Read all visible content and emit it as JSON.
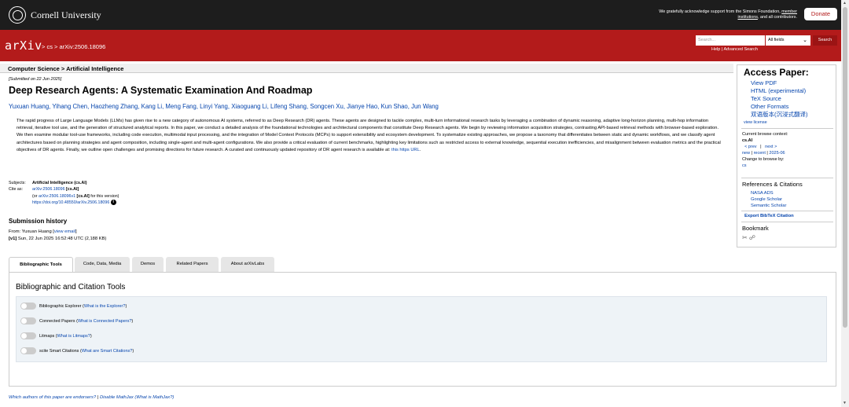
{
  "topbar": {
    "cornell": "Cornell University",
    "ack_line1": "We gratefully acknowledge support from the Simons Foundation,",
    "ack_member": "member",
    "ack_line2_a": "institutions",
    "ack_line2_b": ", and all contributors.",
    "donate": "Donate"
  },
  "header": {
    "logo": "arXiv",
    "breadcrumb": "> cs > arXiv:2506.18096",
    "search_placeholder": "Search...",
    "field_select": "All fields",
    "search_button": "Search",
    "help": "Help",
    "advanced": "Advanced Search"
  },
  "subheader": "Computer Science > Artificial Intelligence",
  "paper": {
    "submitted": "[Submitted on 22 Jun 2025]",
    "title": "Deep Research Agents: A Systematic Examination And Roadmap",
    "authors": "Yuxuan Huang, Yihang Chen, Haozheng Zhang, Kang Li, Meng Fang, Linyi Yang, Xiaoguang Li, Lifeng Shang, Songcen Xu, Jianye Hao, Kun Shao, Jun Wang",
    "abstract": "The rapid progress of Large Language Models (LLMs) has given rise to a new category of autonomous AI systems, referred to as Deep Research (DR) agents. These agents are designed to tackle complex, multi-turn informational research tasks by leveraging a combination of dynamic reasoning, adaptive long-horizon planning, multi-hop information retrieval, iterative tool use, and the generation of structured analytical reports. In this paper, we conduct a detailed analysis of the foundational technologies and architectural components that constitute Deep Research agents. We begin by reviewing information acquisition strategies, contrasting API-based retrieval methods with browser-based exploration. We then examine modular tool-use frameworks, including code execution, multimodal input processing, and the integration of Model Context Protocols (MCPs) to support extensibility and ecosystem development. To systematize existing approaches, we propose a taxonomy that differentiates between static and dynamic workflows, and we classify agent architectures based on planning strategies and agent composition, including single-agent and multi-agent configurations. We also provide a critical evaluation of current benchmarks, highlighting key limitations such as restricted access to external knowledge, sequential execution inefficiencies, and misalignment between evaluation metrics and the practical objectives of DR agents. Finally, we outline open challenges and promising directions for future research. A curated and continuously updated repository of DR agent research is available at:",
    "abstract_link": "this https URL",
    "abstract_end": ".",
    "subjects_label": "Subjects:",
    "subjects": "Artificial Intelligence (cs.AI)",
    "cite_label": "Cite as:",
    "cite_id": "arXiv:2506.18096",
    "cite_cat": "[cs.AI]",
    "cite_or_a": "(or ",
    "cite_v1": "arXiv:2506.18096v1",
    "cite_or_b": " [cs.AI]",
    "cite_or_c": " for this version)",
    "doi": "https://doi.org/10.48550/arXiv.2506.18096",
    "info_icon": "i"
  },
  "history": {
    "title": "Submission history",
    "from": "From: Yuxuan Huang [",
    "view_email": "view email",
    "from_end": "]",
    "v1": "[v1]",
    "v1_text": " Sun, 22 Jun 2025 16:52:48 UTC (2,188 KB)"
  },
  "sidebar": {
    "title": "Access Paper:",
    "links": [
      "View PDF",
      "HTML (experimental)",
      "TeX Source",
      "Other Formats",
      "双语版本(沉浸式翻译)"
    ],
    "license": "view license",
    "context_label": "Current browse context:",
    "context": "cs.AI",
    "prev": "< prev",
    "bar": "|",
    "next": "next >",
    "new": "new",
    "recent": "recent",
    "month": "2025-06",
    "change_label": "Change to browse by:",
    "change": "cs",
    "refs_title": "References & Citations",
    "refs": [
      "NASA ADS",
      "Google Scholar",
      "Semantic Scholar"
    ],
    "bibtex": "Export BibTeX Citation",
    "bookmark": "Bookmark",
    "bookmark_icons": "✂ ☍"
  },
  "tabs": [
    "Bibliographic Tools",
    "Code, Data, Media",
    "Demos",
    "Related Papers",
    "About arXivLabs"
  ],
  "tools": {
    "title": "Bibliographic and Citation Tools",
    "rows": [
      {
        "label": "Bibliographic Explorer",
        "q": "What is the Explorer?"
      },
      {
        "label": "Connected Papers",
        "q": "What is Connected Papers?"
      },
      {
        "label": "Litmaps",
        "q": "What is Litmaps?"
      },
      {
        "label": "scite Smart Citations",
        "q": "What are Smart Citations?"
      }
    ]
  },
  "footer": {
    "endorsers": "Which authors of this paper are endorsers?",
    "sep": "|",
    "disable": "Disable MathJax",
    "what": "(What is MathJax?)"
  }
}
